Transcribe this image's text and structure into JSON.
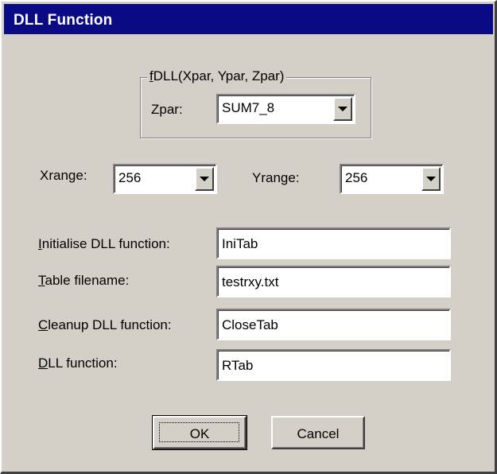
{
  "window": {
    "title": "DLL Function"
  },
  "group": {
    "title": "fDLL(Xpar, Ypar, Zpar)",
    "title_mnemonic": "f",
    "title_rest": "DLL(Xpar, Ypar, Zpar)",
    "zpar_label": "Zpar:",
    "zpar_value": "SUM7_8"
  },
  "ranges": {
    "xrange_label": "Xrange:",
    "xrange_value": "256",
    "yrange_label": "Yrange:",
    "yrange_value": "256"
  },
  "fields": [
    {
      "label": "Initialise DLL function:",
      "mnemonic": "I",
      "rest": "nitialise DLL function:",
      "value": "IniTab"
    },
    {
      "label": "Table filename:",
      "mnemonic": "T",
      "rest": "able filename:",
      "value": "testrxy.txt"
    },
    {
      "label": "Cleanup DLL function:",
      "mnemonic": "C",
      "rest": "leanup DLL function:",
      "value": "CloseTab"
    },
    {
      "label": "DLL function:",
      "mnemonic": "D",
      "rest": "LL function:",
      "value": "RTab"
    }
  ],
  "buttons": {
    "ok_label": "OK",
    "cancel_label": "Cancel"
  },
  "icons": {
    "dropdown": "chevron-down-icon"
  },
  "colors": {
    "titlebar": "#0a0a84",
    "face": "#d4d0c8"
  }
}
